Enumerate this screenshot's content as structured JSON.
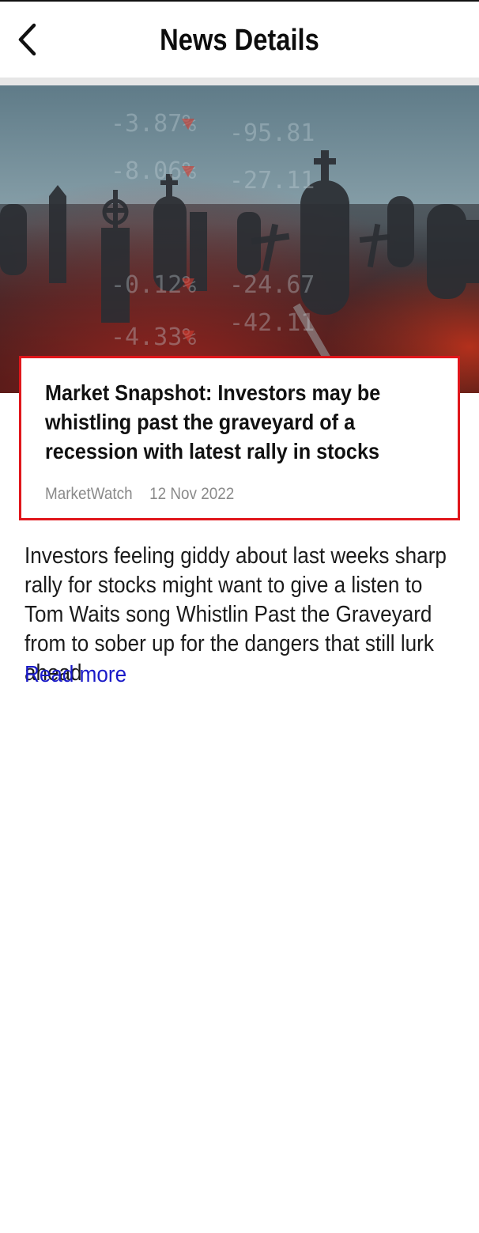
{
  "header": {
    "title": "News Details",
    "back_icon": "chevron-left-icon"
  },
  "article": {
    "image_icon": "graveyard-stock-ticker-image",
    "title": "Market Snapshot: Investors may be whistling past the graveyard of a recession with latest rally in stocks",
    "source": "MarketWatch",
    "date": "12 Nov 2022",
    "summary": "Investors feeling giddy about last weeks sharp rally for stocks might want to give a listen to Tom Waits song Whistlin Past the Graveyard from  to sober up for the dangers that still lurk ahead",
    "read_more_label": "Read more",
    "ticker_values": [
      "-3.87%",
      "-95.81",
      "-8.06%",
      "-27.11",
      "-0.12%",
      "-24.67",
      "-4.33%",
      "-42.11"
    ]
  },
  "colors": {
    "highlight_border": "#e0161b",
    "link": "#1a1ac8",
    "divider": "#e6e6e6"
  }
}
